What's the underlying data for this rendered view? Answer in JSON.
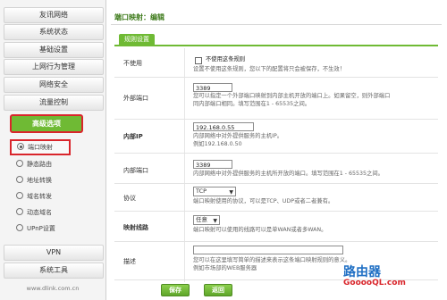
{
  "sidebar": {
    "menu": [
      {
        "label": "友讯网络"
      },
      {
        "label": "系统状态"
      },
      {
        "label": "基础设置"
      },
      {
        "label": "上网行为管理"
      },
      {
        "label": "网络安全"
      },
      {
        "label": "流量控制"
      },
      {
        "label": "高级选项"
      }
    ],
    "submenu": [
      {
        "label": "端口映射",
        "selected": true
      },
      {
        "label": "静态路由"
      },
      {
        "label": "地址转换"
      },
      {
        "label": "域名转发"
      },
      {
        "label": "动态域名"
      },
      {
        "label": "UPnP设置"
      }
    ],
    "bottom_menu": [
      {
        "label": "VPN"
      },
      {
        "label": "系统工具"
      }
    ],
    "footer_url": "www.dlink.com.cn"
  },
  "main": {
    "title": "端口映射：编辑",
    "tab": "规则设置",
    "disable": {
      "label": "不使用",
      "checkbox_label": "不使用这条规则",
      "help": "设置不使用这条规则，您以下的配置将只会被保存，不生效！"
    },
    "external_port": {
      "label": "外部端口",
      "value": "3389",
      "help1": "您可以指定一个外部端口映射到内部主机开放的端口上。如果留空，则外部端口",
      "help2": "同内部端口相同。填写范围在1 - 65535之间。"
    },
    "internal_ip": {
      "label": "内部IP",
      "value": "192.168.0.55",
      "help1": "内部网络中对外提供服务的主机IP。",
      "help2": "例如192.168.0.50"
    },
    "internal_port": {
      "label": "内部端口",
      "value": "3389",
      "help": "内部网络中对外提供服务的主机所开放的端口。填写范围在1 - 65535之间。"
    },
    "protocol": {
      "label": "协议",
      "value": "TCP",
      "help": "端口映射使用的协议，可以是TCP、UDP或者二者兼有。"
    },
    "line": {
      "label": "映射线路",
      "value": "任意",
      "help": "端口映射可以使用的线路可以是单WAN或者多WAN。"
    },
    "description": {
      "label": "描述",
      "value": "",
      "help1": "您可以在这里填写简单的描述来表示这条端口映射规则的意义。",
      "help2": "例如市场部的WEB服务器"
    },
    "buttons": {
      "save": "保存",
      "back": "返回"
    }
  },
  "watermark": {
    "main": "路由器",
    "sub": "GooooQL.com"
  }
}
